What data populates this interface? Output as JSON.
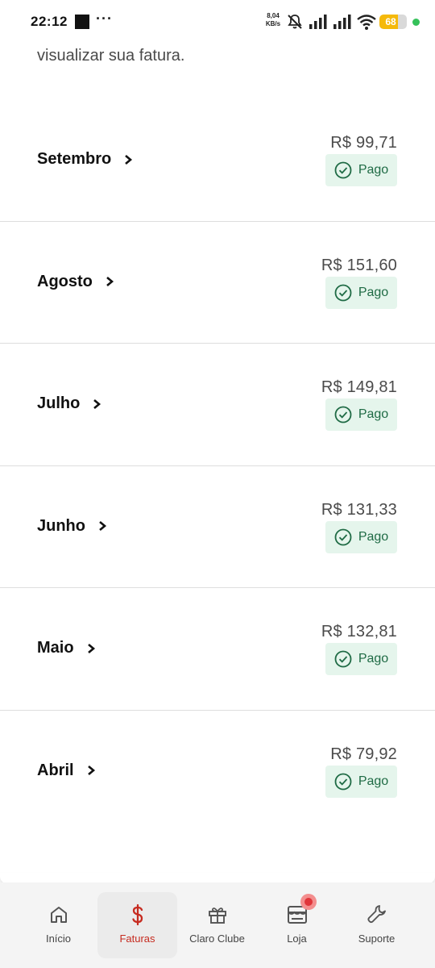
{
  "status_bar": {
    "time": "22:12",
    "overflow": "···",
    "net_speed_value": "8,04",
    "net_speed_unit": "KB/s",
    "battery": "68",
    "battery_level": 0.68,
    "icons": [
      "mute-icon",
      "signal-icon",
      "signal-icon",
      "wifi-icon",
      "battery-icon"
    ]
  },
  "intro_text": "visualizar sua fatura.",
  "invoices": [
    {
      "month": "Setembro",
      "amount": "R$ 99,71",
      "status": "Pago"
    },
    {
      "month": "Agosto",
      "amount": "R$ 151,60",
      "status": "Pago"
    },
    {
      "month": "Julho",
      "amount": "R$ 149,81",
      "status": "Pago"
    },
    {
      "month": "Junho",
      "amount": "R$ 131,33",
      "status": "Pago"
    },
    {
      "month": "Maio",
      "amount": "R$ 132,81",
      "status": "Pago"
    },
    {
      "month": "Abril",
      "amount": "R$ 79,92",
      "status": "Pago"
    }
  ],
  "bottom_nav": {
    "items": [
      {
        "label": "Início",
        "icon": "home-icon"
      },
      {
        "label": "Faturas",
        "icon": "dollar-icon",
        "active": true
      },
      {
        "label": "Claro Clube",
        "icon": "gift-icon"
      },
      {
        "label": "Loja",
        "icon": "store-icon",
        "badge": true
      },
      {
        "label": "Suporte",
        "icon": "wrench-icon"
      }
    ]
  },
  "colors": {
    "accent": "#c62b20",
    "paid_badge_bg": "#e5f5ec",
    "paid_badge_text": "#1f6b45",
    "battery": "#f5b90a",
    "notification_dot": "#35c15a"
  }
}
